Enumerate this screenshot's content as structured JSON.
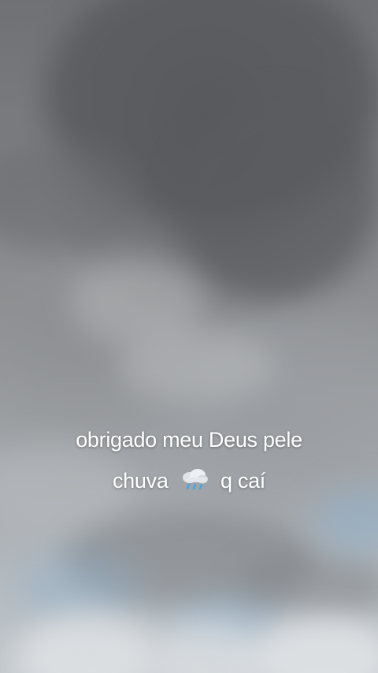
{
  "caption": {
    "line1": "obrigado meu Deus pele",
    "line2_before": "chuva",
    "line2_after": "q caí",
    "icon": "cloud-with-rain-icon"
  },
  "colors": {
    "caption_text": "#ffffff",
    "sky_dark": "#5f6164",
    "sky_light": "#c2c8cd",
    "blue_patch": "#8fb1cc"
  }
}
